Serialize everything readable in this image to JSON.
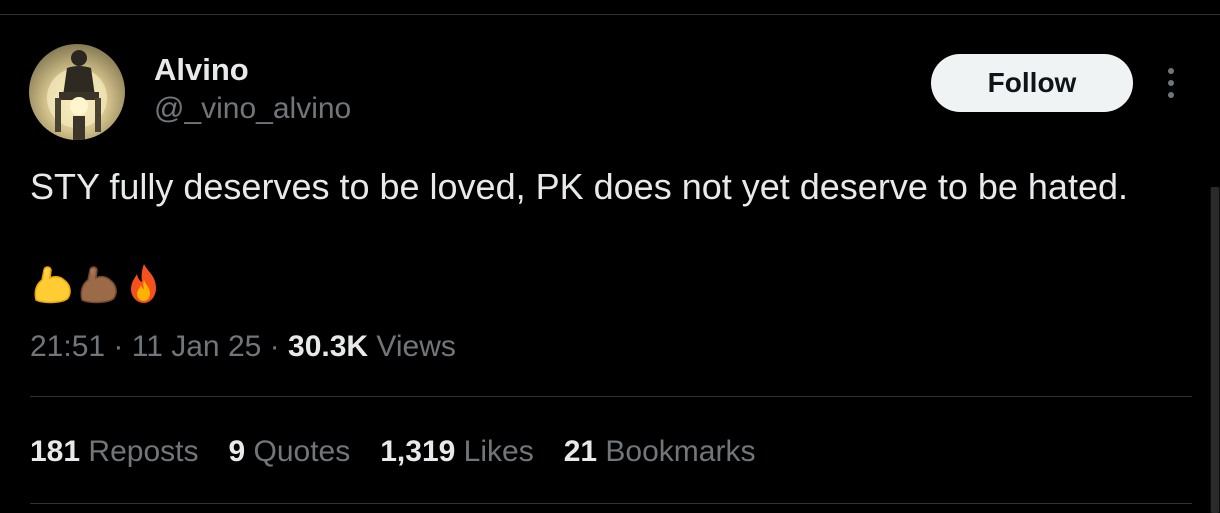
{
  "author": {
    "display_name": "Alvino",
    "handle": "@_vino_alvino"
  },
  "follow_label": "Follow",
  "tweet": {
    "text": "STY fully deserves to be loved, PK does not yet deserve to be hated.",
    "emojis": [
      "flexed-biceps-icon",
      "flexed-biceps-medium-dark-icon",
      "fire-icon"
    ]
  },
  "meta": {
    "time": "21:51",
    "separator": "·",
    "date": "11 Jan 25",
    "views_count": "30.3K",
    "views_label": "Views"
  },
  "stats": {
    "reposts_count": "181",
    "reposts_label": "Reposts",
    "quotes_count": "9",
    "quotes_label": "Quotes",
    "likes_count": "1,319",
    "likes_label": "Likes",
    "bookmarks_count": "21",
    "bookmarks_label": "Bookmarks"
  },
  "colors": {
    "background": "#000000",
    "text_primary": "#e7e9ea",
    "text_secondary": "#71767b",
    "divider": "#2f3336",
    "follow_button_bg": "#eff3f4"
  }
}
